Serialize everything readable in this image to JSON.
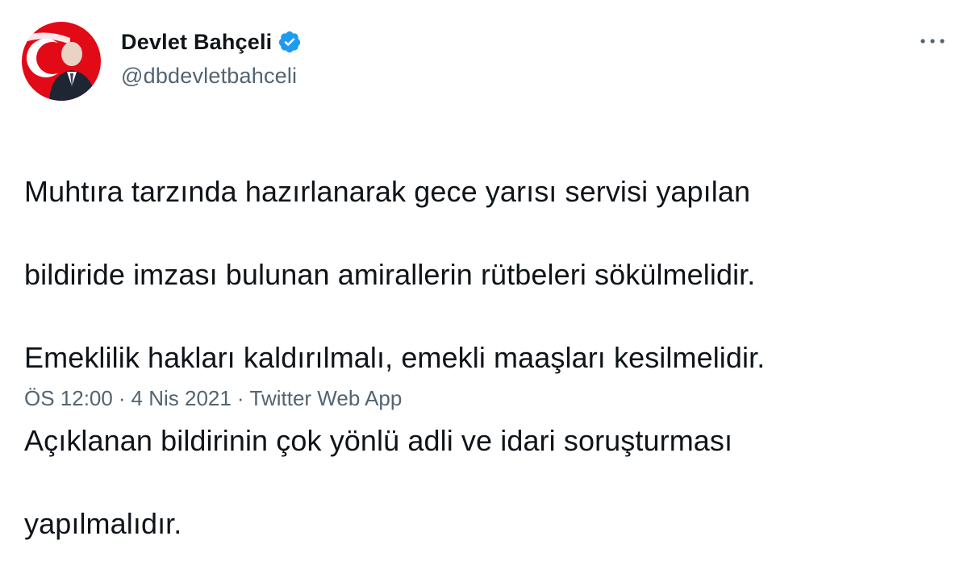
{
  "author": {
    "name": "Devlet Bahçeli",
    "handle": "@dbdevletbahceli",
    "verified": true,
    "avatar_icon": "profile-photo-flag-background"
  },
  "menu_icon": "more-horizontal-icon",
  "tweet": {
    "lines": [
      "Muhtıra tarzında hazırlanarak gece yarısı servisi yapılan",
      "bildiride imzası bulunan amirallerin rütbeleri sökülmelidir.",
      "Emeklilik hakları kaldırılmalı, emekli maaşları kesilmelidir.",
      "Açıklanan bildirinin çok yönlü adli ve idari soruşturması",
      "yapılmalıdır."
    ]
  },
  "meta": {
    "time": "ÖS 12:00",
    "separator": "·",
    "date": "4 Nis 2021",
    "source": "Twitter Web App"
  },
  "colors": {
    "text": "#0f1419",
    "secondary": "#536471",
    "verified": "#1d9bf0",
    "flag_red": "#e30a17"
  }
}
